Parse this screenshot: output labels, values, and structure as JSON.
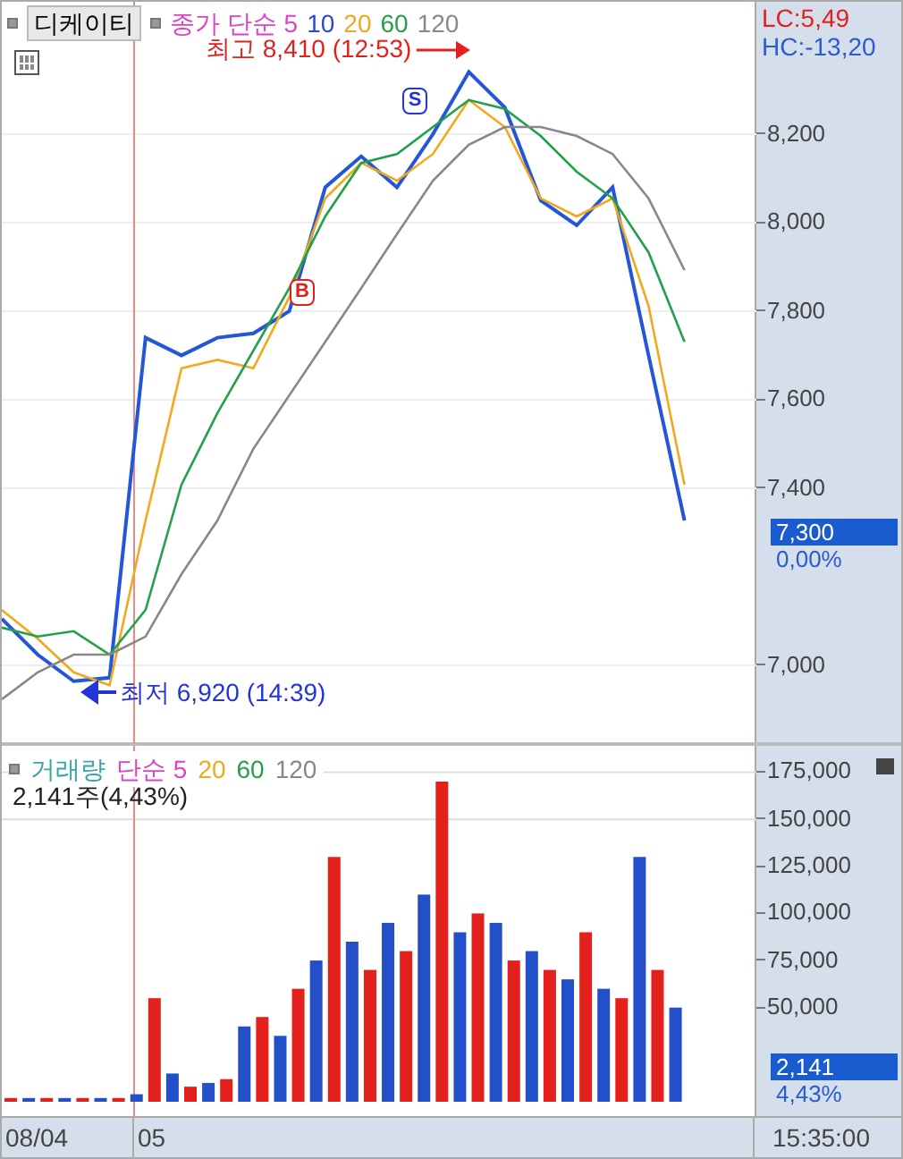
{
  "price_panel": {
    "symbol_button": "디케이티",
    "legend": [
      {
        "text": "종가 단순 5",
        "color": "#e23fc4"
      },
      {
        "text": "10",
        "color": "#2a4bd0"
      },
      {
        "text": "20",
        "color": "#f2a81d"
      },
      {
        "text": "60",
        "color": "#22a04a"
      },
      {
        "text": "120",
        "color": "#888888"
      }
    ],
    "lc": "LC:5,49",
    "hc": "HC:-13,20",
    "current_price": "7,300",
    "current_change": "0,00%",
    "high_label": "최고 8,410 (12:53)",
    "low_label": "최저 6,920 (14:39)",
    "signals": [
      {
        "text": "B",
        "kind": "buy"
      },
      {
        "text": "S",
        "kind": "sell"
      }
    ],
    "chart_data": {
      "type": "line",
      "grid": true,
      "ylim": [
        6822,
        8499
      ],
      "categories": [
        null,
        null,
        null,
        null,
        null,
        null,
        null,
        null,
        null,
        null,
        null,
        null,
        null,
        null,
        null,
        null,
        null,
        null,
        null,
        null,
        null,
        null
      ],
      "yticks": [
        {
          "value": 7000,
          "label": "7,000"
        },
        {
          "value": 7400,
          "label": "7,400"
        },
        {
          "value": 7600,
          "label": "7,600"
        },
        {
          "value": 7800,
          "label": "7,800"
        },
        {
          "value": 8000,
          "label": "8,000"
        },
        {
          "value": 8200,
          "label": "8,200"
        }
      ],
      "series": [
        {
          "color": "#2356d8",
          "values": [
            7105,
            7024,
            6964,
            6972,
            7740,
            7700,
            7740,
            7750,
            7800,
            8080,
            8150,
            8080,
            8200,
            8340,
            8260,
            8050,
            7994,
            8080,
            7700,
            7327,
            null,
            null
          ]
        },
        {
          "color": "#f2a81d",
          "values": [
            7125,
            7060,
            6984,
            6955,
            7327,
            7671,
            7690,
            7671,
            7832,
            8055,
            8135,
            8095,
            8155,
            8277,
            8216,
            8055,
            8014,
            8055,
            7812,
            7408,
            null,
            null
          ]
        },
        {
          "color": "#22a04a",
          "values": [
            7085,
            7065,
            7077,
            7024,
            7125,
            7408,
            7570,
            7711,
            7852,
            8014,
            8135,
            8155,
            8216,
            8277,
            8257,
            8196,
            8115,
            8055,
            7933,
            7731,
            null,
            null
          ]
        },
        {
          "color": "#888888",
          "values": [
            6923,
            6984,
            7024,
            7024,
            7065,
            7206,
            7327,
            7489,
            7610,
            7731,
            7852,
            7974,
            8095,
            8176,
            8216,
            8216,
            8196,
            8155,
            8055,
            7893,
            null,
            null
          ]
        }
      ]
    }
  },
  "volume_panel": {
    "legend": [
      {
        "text": "거래량",
        "color": "#3aa6a6"
      },
      {
        "text": "단순 5",
        "color": "#e23fc4"
      },
      {
        "text": "20",
        "color": "#f2a81d"
      },
      {
        "text": "60",
        "color": "#22a04a"
      },
      {
        "text": "120",
        "color": "#888888"
      }
    ],
    "summary": "2,141주(4,43%)",
    "current_volume": "2,141",
    "current_ratio": "4,43%",
    "chart_data": {
      "type": "bar",
      "grid": true,
      "ylim": [
        0,
        189000
      ],
      "categories": [
        null,
        null,
        null,
        null,
        null,
        null,
        null,
        null,
        null,
        null,
        null,
        null,
        null,
        null,
        null,
        null,
        null,
        null,
        null,
        null,
        null,
        null,
        null,
        null,
        null,
        null,
        null,
        null,
        null,
        null,
        null,
        null,
        null,
        null,
        null,
        null,
        null,
        null,
        null,
        null,
        null,
        null
      ],
      "yticks": [
        {
          "value": 50000,
          "label": "50,000"
        },
        {
          "value": 75000,
          "label": "75,000"
        },
        {
          "value": 100000,
          "label": "100,000"
        },
        {
          "value": 125000,
          "label": "125,000"
        },
        {
          "value": 150000,
          "label": "150,000"
        },
        {
          "value": 175000,
          "label": "175,000"
        }
      ],
      "series": [
        {
          "color": "#e3201c",
          "values": [
            2000,
            null,
            2000,
            null,
            2000,
            null,
            2000,
            null,
            55000,
            null,
            8000,
            null,
            12000,
            null,
            45000,
            null,
            60000,
            null,
            130000,
            null,
            70000,
            null,
            80000,
            null,
            170000,
            null,
            100000,
            null,
            75000,
            null,
            70000,
            null,
            90000,
            null,
            55000,
            null,
            70000,
            null,
            null,
            null,
            null,
            null
          ]
        },
        {
          "color": "#2350c8",
          "values": [
            null,
            2000,
            null,
            2000,
            null,
            2000,
            null,
            4000,
            null,
            15000,
            null,
            10000,
            null,
            40000,
            null,
            35000,
            null,
            75000,
            null,
            85000,
            null,
            95000,
            null,
            110000,
            null,
            90000,
            null,
            95000,
            null,
            80000,
            null,
            65000,
            null,
            60000,
            null,
            130000,
            null,
            50000,
            null,
            null,
            null,
            null
          ]
        }
      ]
    }
  },
  "time_axis": {
    "labels": [
      "08/04",
      "05"
    ],
    "time": "15:35:00"
  }
}
